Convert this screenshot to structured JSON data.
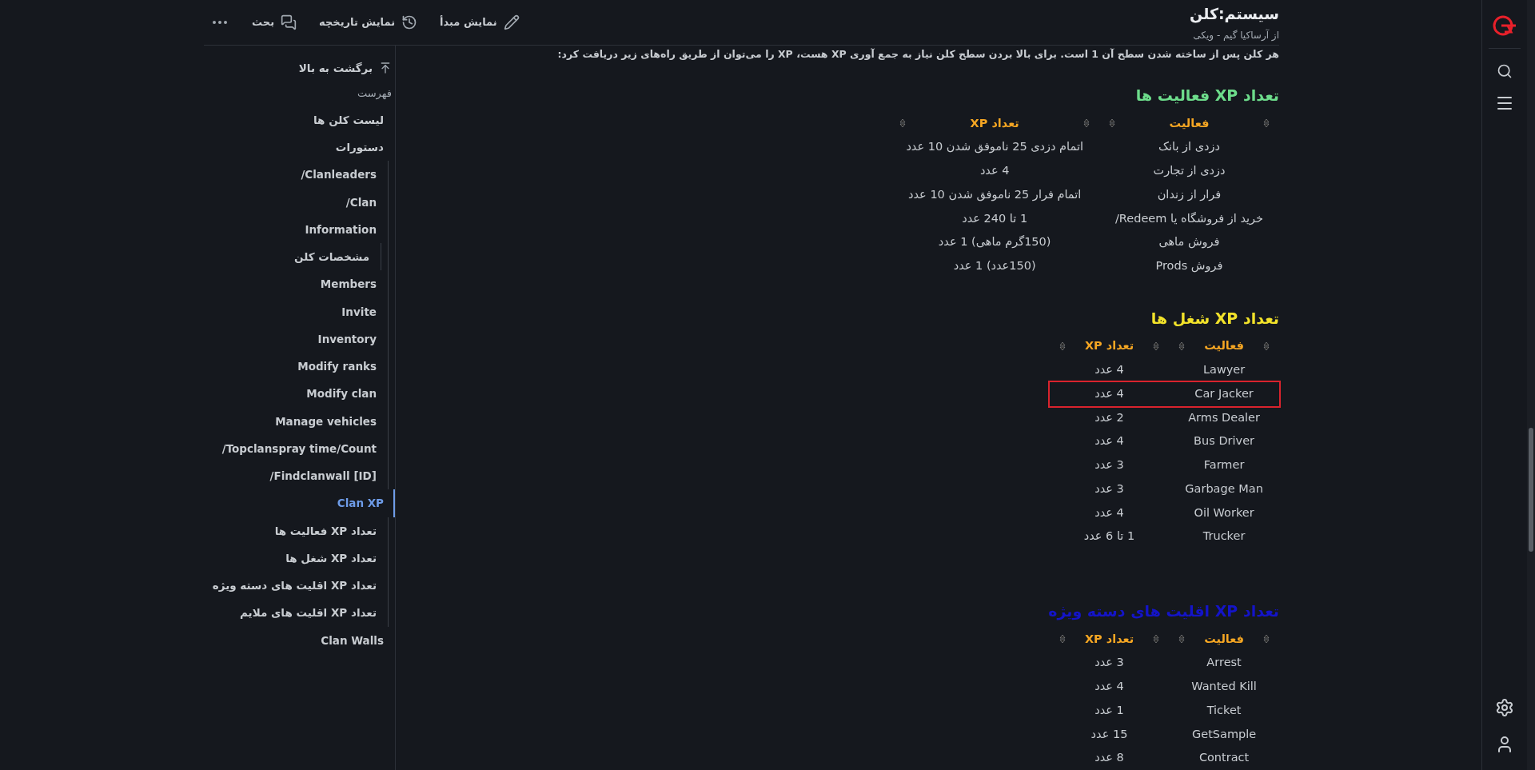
{
  "header": {
    "title": "سیستم:کلن",
    "subtitle": "از آرساکیا گیم - ویکی",
    "actions": [
      {
        "kind": "source",
        "label": "نمایش مبدأ"
      },
      {
        "kind": "history",
        "label": "نمایش تاریخچه"
      },
      {
        "kind": "talk",
        "label": "بحث"
      }
    ]
  },
  "toc": {
    "back_to_top": "برگشت به بالا",
    "title": "فهرست",
    "items": [
      {
        "label": "لیست کلن ها",
        "selected": false
      },
      {
        "label": "دستورات",
        "selected": false,
        "children": [
          {
            "label": "Clanleaders/",
            "selected": false
          },
          {
            "label": "Clan/",
            "selected": false
          },
          {
            "label": "Information",
            "selected": false,
            "children": [
              {
                "label": "مشخصات کلن",
                "selected": false
              }
            ]
          },
          {
            "label": "Members",
            "selected": false
          },
          {
            "label": "Invite",
            "selected": false
          },
          {
            "label": "Inventory",
            "selected": false
          },
          {
            "label": "Modify ranks",
            "selected": false
          },
          {
            "label": "Modify clan",
            "selected": false
          },
          {
            "label": "Manage vehicles",
            "selected": false
          },
          {
            "label": "Topclanspray time/Count/",
            "selected": false
          },
          {
            "label": "Findclanwall [ID]/",
            "selected": false
          }
        ]
      },
      {
        "label": "Clan XP",
        "selected": true,
        "children": [
          {
            "label": "تعداد XP فعالیت ها",
            "selected": false
          },
          {
            "label": "تعداد XP شغل ها",
            "selected": false
          },
          {
            "label": "تعداد XP اقلیت های دسته ویژه",
            "selected": false
          },
          {
            "label": "تعداد XP اقلیت های ملایم",
            "selected": false
          }
        ]
      },
      {
        "label": "Clan Walls",
        "selected": false
      }
    ]
  },
  "intro": "هر کلن پس از ساخته شدن سطح آن 1 است. برای بالا بردن سطح کلن نیاز به جمع آوری XP هست، XP را می‌توان از طریق راه‌های زیر دریافت کرد:",
  "sections": [
    {
      "heading": "تعداد XP فعالیت ها",
      "color": "#6ddc8b",
      "columns": [
        "فعالیت",
        "تعداد XP"
      ],
      "rows": [
        {
          "cells": [
            "دزدی از بانک",
            "اتمام دزدی 25 ناموفق شدن 10 عدد"
          ],
          "highlighted": false
        },
        {
          "cells": [
            "دزدی از تجارت",
            "4 عدد"
          ],
          "highlighted": false
        },
        {
          "cells": [
            "فرار از زندان",
            "اتمام فرار 25 ناموفق شدن 10 عدد"
          ],
          "highlighted": false
        },
        {
          "cells": [
            "خرید از فروشگاه یا Redeem/",
            "1 تا 240 عدد"
          ],
          "highlighted": false
        },
        {
          "cells": [
            "فروش ماهی",
            "(150گرم ماهی) 1 عدد"
          ],
          "highlighted": false
        },
        {
          "cells": [
            "فروش Prods",
            "(150عدد) 1 عدد"
          ],
          "highlighted": false
        }
      ]
    },
    {
      "heading": "تعداد XP شغل ها",
      "color": "#f2e22a",
      "columns": [
        "فعالیت",
        "تعداد XP"
      ],
      "rows": [
        {
          "cells": [
            "Lawyer",
            "4 عدد"
          ],
          "highlighted": false
        },
        {
          "cells": [
            "Car Jacker",
            "4 عدد"
          ],
          "highlighted": true
        },
        {
          "cells": [
            "Arms Dealer",
            "2 عدد"
          ],
          "highlighted": false
        },
        {
          "cells": [
            "Bus Driver",
            "4 عدد"
          ],
          "highlighted": false
        },
        {
          "cells": [
            "Farmer",
            "3 عدد"
          ],
          "highlighted": false
        },
        {
          "cells": [
            "Garbage Man",
            "3 عدد"
          ],
          "highlighted": false
        },
        {
          "cells": [
            "Oil Worker",
            "4 عدد"
          ],
          "highlighted": false
        },
        {
          "cells": [
            "Trucker",
            "1 تا 6 عدد"
          ],
          "highlighted": false
        }
      ]
    },
    {
      "heading": "تعداد XP اقلیت های دسته ویژه",
      "color": "#1414c8",
      "columns": [
        "فعالیت",
        "تعداد XP"
      ],
      "rows": [
        {
          "cells": [
            "Arrest",
            "3 عدد"
          ],
          "highlighted": false
        },
        {
          "cells": [
            "Wanted Kill",
            "4 عدد"
          ],
          "highlighted": false
        },
        {
          "cells": [
            "Ticket",
            "1 عدد"
          ],
          "highlighted": false
        },
        {
          "cells": [
            "GetSample",
            "15 عدد"
          ],
          "highlighted": false
        },
        {
          "cells": [
            "Contract",
            "8 عدد"
          ],
          "highlighted": false
        }
      ]
    }
  ]
}
